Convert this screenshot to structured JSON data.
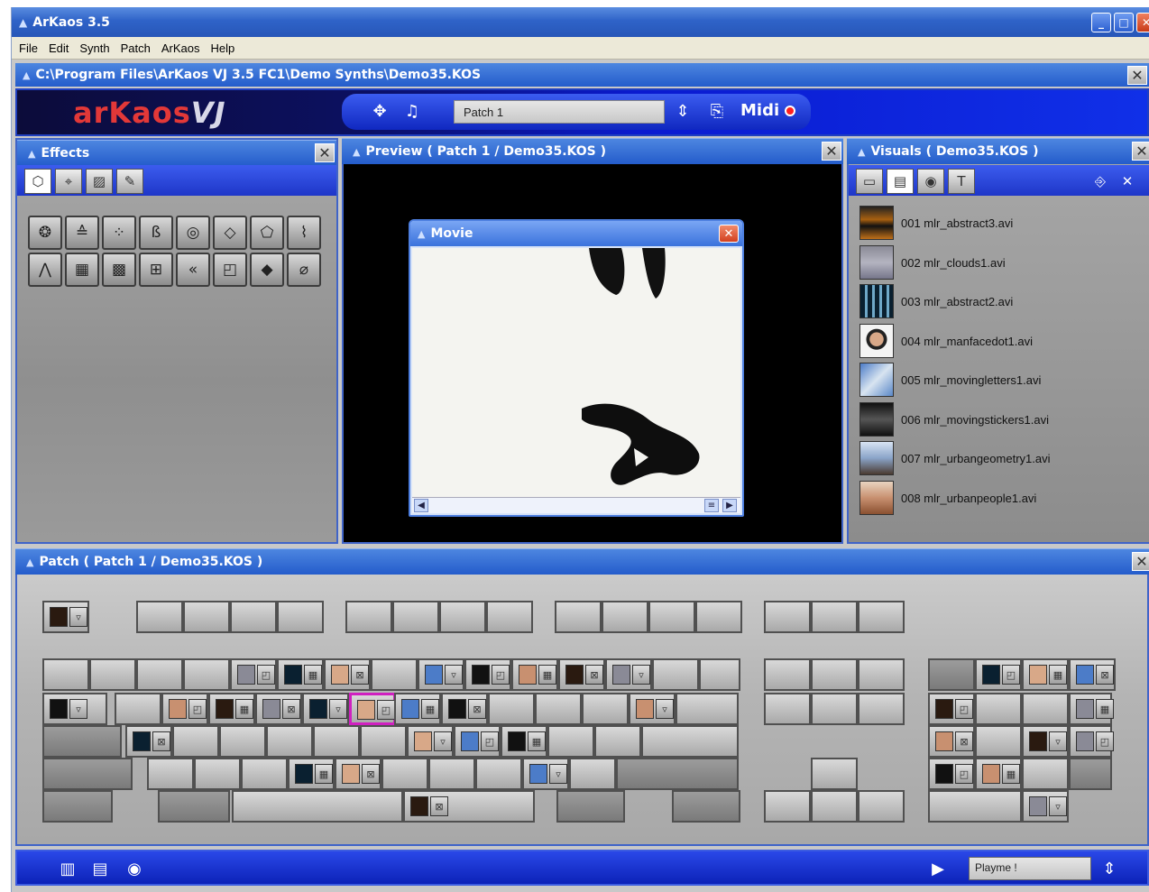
{
  "window": {
    "title": "ArKaos 3.5"
  },
  "menu": [
    "File",
    "Edit",
    "Synth",
    "Patch",
    "ArKaos",
    "Help"
  ],
  "document_path": "C:\\Program Files\\ArKaos VJ 3.5 FC1\\Demo Synths\\Demo35.KOS",
  "toolbar": {
    "brand_text": "arKaos",
    "brand_vj": "VJ",
    "patch_name": "Patch 1",
    "midi_label": "Midi"
  },
  "effects": {
    "title": "Effects"
  },
  "preview": {
    "title": "Preview ( Patch 1 / Demo35.KOS )",
    "movie_title": "Movie"
  },
  "visuals": {
    "title": "Visuals ( Demo35.KOS )",
    "items": [
      "001 mlr_abstract3.avi",
      "002 mlr_clouds1.avi",
      "003 mlr_abstract2.avi",
      "004 mlr_manfacedot1.avi",
      "005 mlr_movingletters1.avi",
      "006 mlr_movingstickers1.avi",
      "007 mlr_urbangeometry1.avi",
      "008 mlr_urbanpeople1.avi"
    ]
  },
  "patch": {
    "title": "Patch ( Patch 1 / Demo35.KOS )"
  },
  "bottom": {
    "playlist_value": "Playme !"
  },
  "colors": {
    "accent_blue": "#245ccb",
    "brand_red": "#e23838",
    "selected_key": "#d020c0"
  }
}
